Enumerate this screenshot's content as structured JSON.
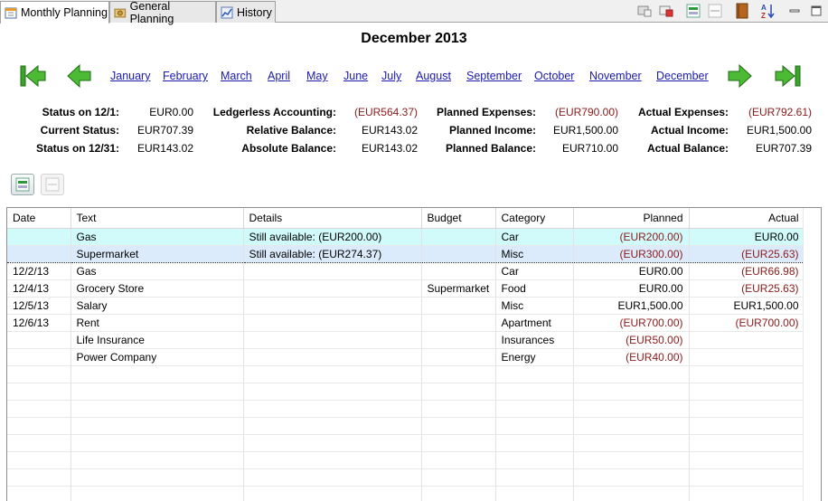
{
  "tabs": [
    {
      "label": "Monthly Planning",
      "icon": "calendar-icon"
    },
    {
      "label": "General Planning",
      "icon": "money-icon"
    },
    {
      "label": "History",
      "icon": "chart-icon"
    }
  ],
  "toolbar_icons": [
    "import-icon",
    "export-icon",
    "add-row-icon",
    "remove-row-icon",
    "book-icon",
    "sort-az-icon",
    "minimize-icon",
    "maximize-icon"
  ],
  "title": "December 2013",
  "months": [
    "January",
    "February",
    "March",
    "April",
    "May",
    "June",
    "July",
    "August",
    "September",
    "October",
    "November",
    "December"
  ],
  "stats": {
    "col1": [
      {
        "label": "Status on 12/1:",
        "value": "EUR0.00"
      },
      {
        "label": "Current Status:",
        "value": "EUR707.39"
      },
      {
        "label": "Status on 12/31:",
        "value": "EUR143.02"
      }
    ],
    "col2": [
      {
        "label": "Ledgerless Accounting:",
        "value": "(EUR564.37)"
      },
      {
        "label": "Relative Balance:",
        "value": "EUR143.02"
      },
      {
        "label": "Absolute Balance:",
        "value": "EUR143.02"
      }
    ],
    "col3": [
      {
        "label": "Planned Expenses:",
        "value": "(EUR790.00)"
      },
      {
        "label": "Planned Income:",
        "value": "EUR1,500.00"
      },
      {
        "label": "Planned Balance:",
        "value": "EUR710.00"
      }
    ],
    "col4": [
      {
        "label": "Actual Expenses:",
        "value": "(EUR792.61)"
      },
      {
        "label": "Actual Income:",
        "value": "EUR1,500.00"
      },
      {
        "label": "Actual Balance:",
        "value": "EUR707.39"
      }
    ]
  },
  "table": {
    "headers": {
      "date": "Date",
      "text": "Text",
      "details": "Details",
      "budget": "Budget",
      "category": "Category",
      "planned": "Planned",
      "actual": "Actual"
    },
    "rows": [
      {
        "date": "",
        "text": "Gas",
        "details": "Still available: (EUR200.00)",
        "budget": "",
        "category": "Car",
        "planned": "(EUR200.00)",
        "actual": "EUR0.00"
      },
      {
        "date": "",
        "text": "Supermarket",
        "details": "Still available: (EUR274.37)",
        "budget": "",
        "category": "Misc",
        "planned": "(EUR300.00)",
        "actual": "(EUR25.63)"
      },
      {
        "date": "12/2/13",
        "text": "Gas",
        "details": "",
        "budget": "",
        "category": "Car",
        "planned": "EUR0.00",
        "actual": "(EUR66.98)"
      },
      {
        "date": "12/4/13",
        "text": "Grocery Store",
        "details": "",
        "budget": "Supermarket",
        "category": "Food",
        "planned": "EUR0.00",
        "actual": "(EUR25.63)"
      },
      {
        "date": "12/5/13",
        "text": "Salary",
        "details": "",
        "budget": "",
        "category": "Misc",
        "planned": "EUR1,500.00",
        "actual": "EUR1,500.00"
      },
      {
        "date": "12/6/13",
        "text": "Rent",
        "details": "",
        "budget": "",
        "category": "Apartment",
        "planned": "(EUR700.00)",
        "actual": "(EUR700.00)"
      },
      {
        "date": "",
        "text": "Life Insurance",
        "details": "",
        "budget": "",
        "category": "Insurances",
        "planned": "(EUR50.00)",
        "actual": ""
      },
      {
        "date": "",
        "text": "Power Company",
        "details": "",
        "budget": "",
        "category": "Energy",
        "planned": "(EUR40.00)",
        "actual": ""
      }
    ]
  },
  "colors": {
    "negative": "#8b1a1a",
    "link": "#1a1ab0",
    "selected_row": "#d1fbfb",
    "focus_row": "#dcebfb",
    "arrow_green": "#3aa52a"
  }
}
